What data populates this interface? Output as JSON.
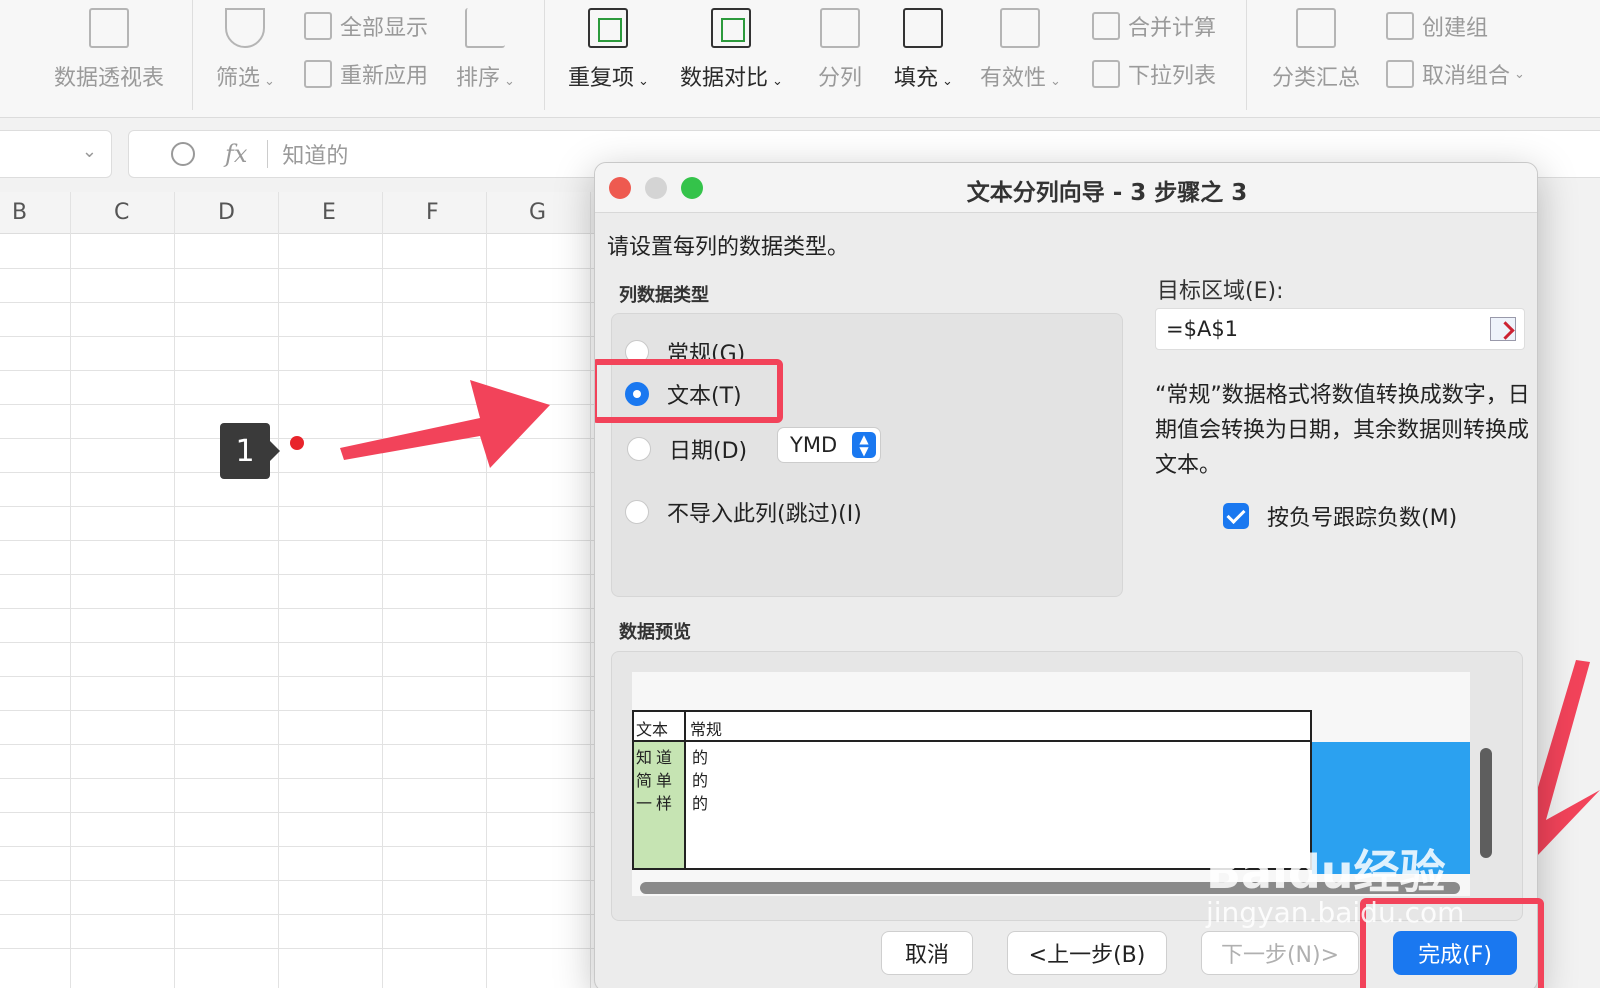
{
  "ribbon": {
    "pivot": "数据透视表",
    "filter": "筛选",
    "show_all": "全部显示",
    "reapply": "重新应用",
    "sort": "排序",
    "duplicates": "重复项",
    "compare": "数据对比",
    "split": "分列",
    "fill": "填充",
    "validity": "有效性",
    "merge_calc": "合并计算",
    "dropdown_list": "下拉列表",
    "subtotal": "分类汇总",
    "group": "创建组",
    "ungroup": "取消组合"
  },
  "formula_bar": {
    "fx": "fx",
    "content": "知道的"
  },
  "columns": [
    "B",
    "C",
    "D",
    "E",
    "F",
    "G"
  ],
  "annotation": {
    "step": "1"
  },
  "dialog": {
    "title": "文本分列向导 - 3 步骤之 3",
    "prompt": "请设置每列的数据类型。",
    "column_type_label": "列数据类型",
    "options": {
      "general": "常规(G)",
      "text": "文本(T)",
      "date": "日期(D)",
      "skip": "不导入此列(跳过)(I)"
    },
    "selected": "text",
    "date_format": "YMD",
    "dest_label": "目标区域(E):",
    "dest_value": "=$A$1",
    "description": "“常规”数据格式将数值转换成数字，日期值会转换为日期，其余数据则转换成文本。",
    "track_negative": "按负号跟踪负数(M)",
    "preview_label": "数据预览",
    "preview": {
      "headers": [
        "文本",
        "常规"
      ],
      "col1": [
        "知道",
        "简单",
        "一样"
      ],
      "col2": [
        "的",
        "的",
        "的"
      ]
    },
    "buttons": {
      "cancel": "取消",
      "back": "<上一步(B)",
      "next": "下一步(N)>",
      "finish": "完成(F)"
    }
  },
  "watermark": {
    "brand": "Baidu经验",
    "url": "jingyan.baidu.com"
  },
  "colors": {
    "accent": "#1a78f0",
    "highlight": "#f2435a"
  }
}
